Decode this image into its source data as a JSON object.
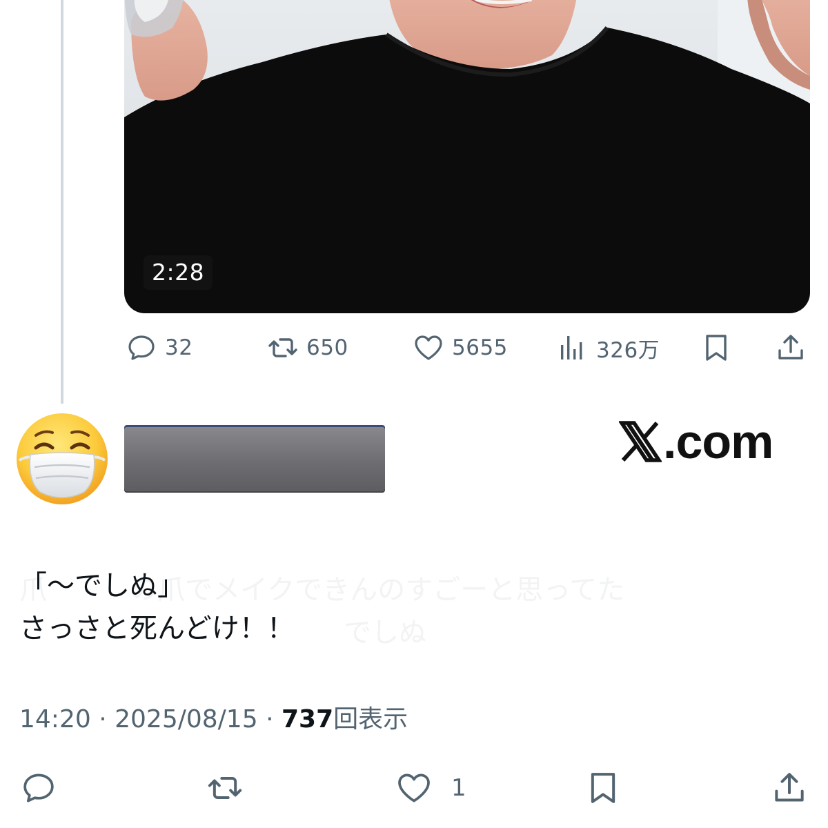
{
  "video": {
    "duration": "2:28"
  },
  "post_actions": {
    "reply_count": "32",
    "repost_count": "650",
    "like_count": "5655",
    "view_count": "326万"
  },
  "reply": {
    "logo_text": ".com",
    "text_line_1": "「〜でしぬ」",
    "text_line_2": "さっさと死んどけ！！",
    "time": "14:20",
    "date": "2025/08/15",
    "separator": "·",
    "views_count": "737",
    "views_label": "回表示",
    "like_count": "1"
  },
  "ghost_text": {
    "line_1": "爪　　　の爪でメイクできんのすごーと思ってた",
    "line_2": "でしぬ"
  },
  "icons": {
    "reply": "speech-bubble-icon",
    "repost": "repost-arrows-icon",
    "like": "heart-icon",
    "views": "bar-chart-icon",
    "bookmark": "bookmark-icon",
    "share": "share-upload-icon",
    "avatar": "face-with-medical-mask-emoji",
    "logo": "x-logo-icon"
  },
  "colors": {
    "icon_gray": "#536471",
    "text": "#0f1419",
    "thread_line": "#cfd9de",
    "redaction": "#6e6e72"
  }
}
